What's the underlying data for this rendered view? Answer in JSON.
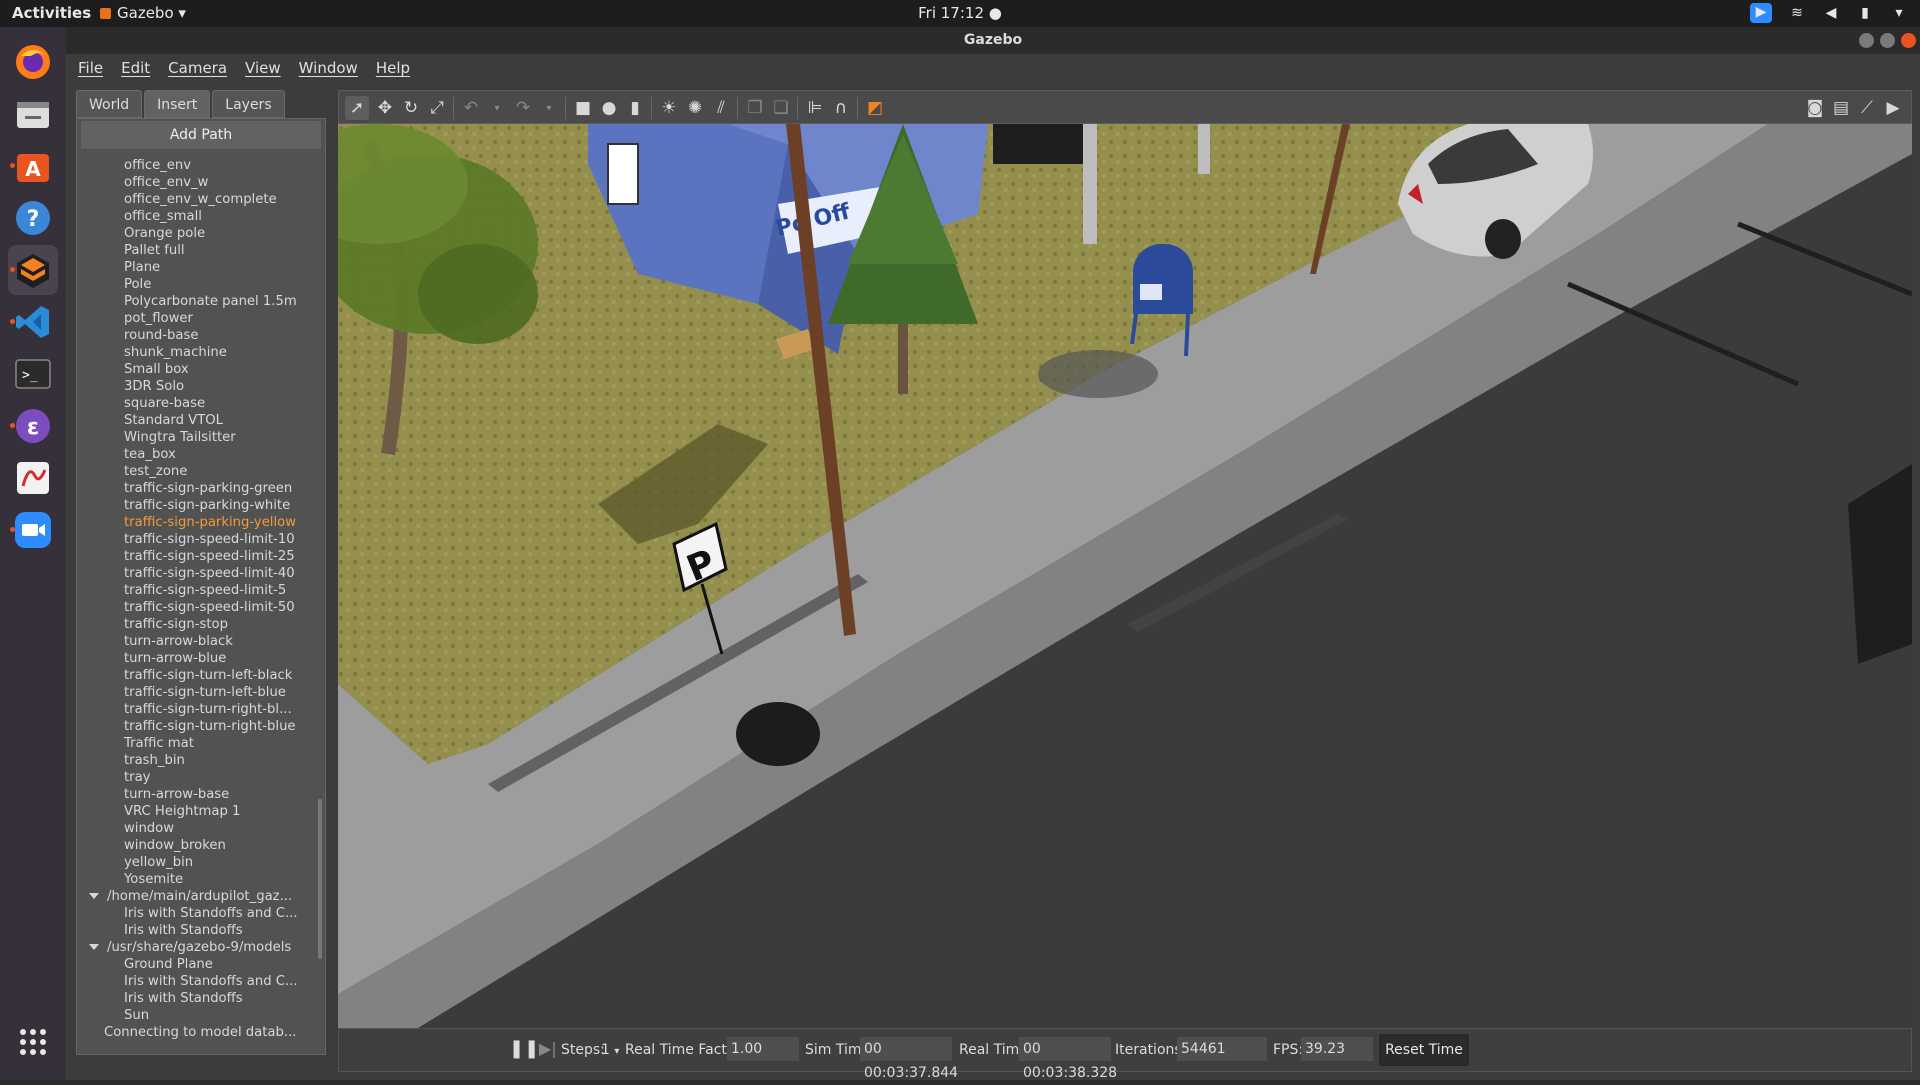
{
  "topbar": {
    "activities": "Activities",
    "app_name": "Gazebo",
    "clock": "Fri 17:12 ●"
  },
  "window": {
    "title": "Gazebo"
  },
  "menu": [
    "File",
    "Edit",
    "Camera",
    "View",
    "Window",
    "Help"
  ],
  "tabs": [
    "World",
    "Insert",
    "Layers"
  ],
  "active_tab": "Insert",
  "insert": {
    "add_path_label": "Add Path",
    "models": [
      "office_env",
      "office_env_w",
      "office_env_w_complete",
      "office_small",
      "Orange pole",
      "Pallet full",
      "Plane",
      "Pole",
      "Polycarbonate panel 1.5m",
      "pot_flower",
      "round-base",
      "shunk_machine",
      "Small box",
      "3DR Solo",
      "square-base",
      "Standard VTOL",
      "Wingtra Tailsitter",
      "tea_box",
      "test_zone",
      "traffic-sign-parking-green",
      "traffic-sign-parking-white",
      "traffic-sign-parking-yellow",
      "traffic-sign-speed-limit-10",
      "traffic-sign-speed-limit-25",
      "traffic-sign-speed-limit-40",
      "traffic-sign-speed-limit-5",
      "traffic-sign-speed-limit-50",
      "traffic-sign-stop",
      "turn-arrow-black",
      "turn-arrow-blue",
      "traffic-sign-turn-left-black",
      "traffic-sign-turn-left-blue",
      "traffic-sign-turn-right-bl...",
      "traffic-sign-turn-right-blue",
      "Traffic mat",
      "trash_bin",
      "tray",
      "turn-arrow-base",
      "VRC Heightmap 1",
      "window",
      "window_broken",
      "yellow_bin",
      "Yosemite"
    ],
    "selected_model": "traffic-sign-parking-yellow",
    "paths": [
      {
        "path": "/home/main/ardupilot_gaz...",
        "models": [
          "Iris with Standoffs and C...",
          "Iris with Standoffs"
        ]
      },
      {
        "path": "/usr/share/gazebo-9/models",
        "models": [
          "Ground Plane",
          "Iris with Standoffs and C...",
          "Iris with Standoffs",
          "Sun"
        ]
      }
    ],
    "status": "Connecting to model datab..."
  },
  "viewport": {
    "building_sign": "Po   Off",
    "parking_sign": "P"
  },
  "bottombar": {
    "steps_label": "Steps:",
    "steps_value": "1",
    "rtf_label": "Real Time Factor:",
    "rtf_value": "1.00",
    "sim_time_label": "Sim Time:",
    "sim_time_value": "00 00:03:37.844",
    "real_time_label": "Real Time:",
    "real_time_value": "00 00:03:38.328",
    "iterations_label": "Iterations:",
    "iterations_value": "54461",
    "fps_label": "FPS:",
    "fps_value": "39.23",
    "reset_label": "Reset Time"
  },
  "colors": {
    "accent": "#e95420",
    "selected_model": "#f39a3c",
    "panel_bg": "#525252",
    "sidewalk": "#9c9c9c",
    "road": "#3d3d3d",
    "grass": "#8a8a4a",
    "building_blue": "#4a66b0"
  },
  "dock_icons": [
    "firefox-icon",
    "files-icon",
    "software-center-icon",
    "help-icon",
    "gazebo-icon",
    "vscode-icon",
    "terminal-icon",
    "emacs-icon",
    "pdf-viewer-icon",
    "zoom-icon",
    "app-grid-icon"
  ]
}
